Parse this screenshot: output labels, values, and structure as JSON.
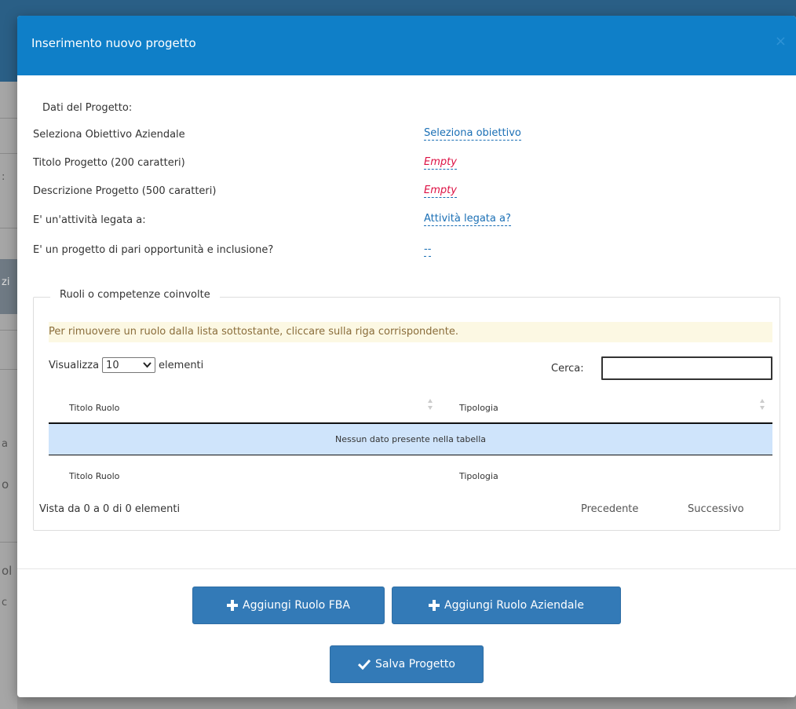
{
  "modal": {
    "title": "Inserimento nuovo progetto",
    "close": "×"
  },
  "project": {
    "section_label": "Dati del Progetto:",
    "fields": [
      {
        "label": "Seleziona Obiettivo Aziendale",
        "value": "Seleziona obiettivo"
      },
      {
        "label": "Titolo Progetto (200 caratteri)",
        "value": "Empty"
      },
      {
        "label": "Descrizione Progetto (500 caratteri)",
        "value": "Empty"
      },
      {
        "label": "E' un'attività legata a:",
        "value": "Attività legata a?"
      },
      {
        "label": "E' un progetto di pari opportunità e inclusione?",
        "value": "--"
      }
    ]
  },
  "roles": {
    "legend": "Ruoli o competenze coinvolte",
    "notice": "Per rimuovere un ruolo dalla lista sottostante, cliccare sulla riga corrispondente.",
    "length_prefix": "Visualizza",
    "length_value": "10",
    "length_suffix": "elementi",
    "search_label": "Cerca:",
    "search_value": "",
    "columns": [
      "Titolo Ruolo",
      "Tipologia"
    ],
    "empty_message": "Nessun dato presente nella tabella",
    "footer_columns": [
      "Titolo Ruolo",
      "Tipologia"
    ],
    "info": "Vista da 0 a 0 di 0 elementi",
    "prev": "Precedente",
    "next": "Successivo"
  },
  "actions": {
    "add_fba": "Aggiungi Ruolo FBA",
    "add_company": "Aggiungi Ruolo Aziendale",
    "save": "Salva Progetto"
  },
  "background": {
    "fragments": [
      ":",
      "zi",
      "a",
      "o",
      "ol",
      "o",
      "c"
    ]
  },
  "colors": {
    "header": "#0f7fc8",
    "button": "#337ab7",
    "link": "#1a6fb5",
    "empty": "#dd1144",
    "notice_bg": "#fcf8e3",
    "empty_row_bg": "#cfe4fb"
  }
}
